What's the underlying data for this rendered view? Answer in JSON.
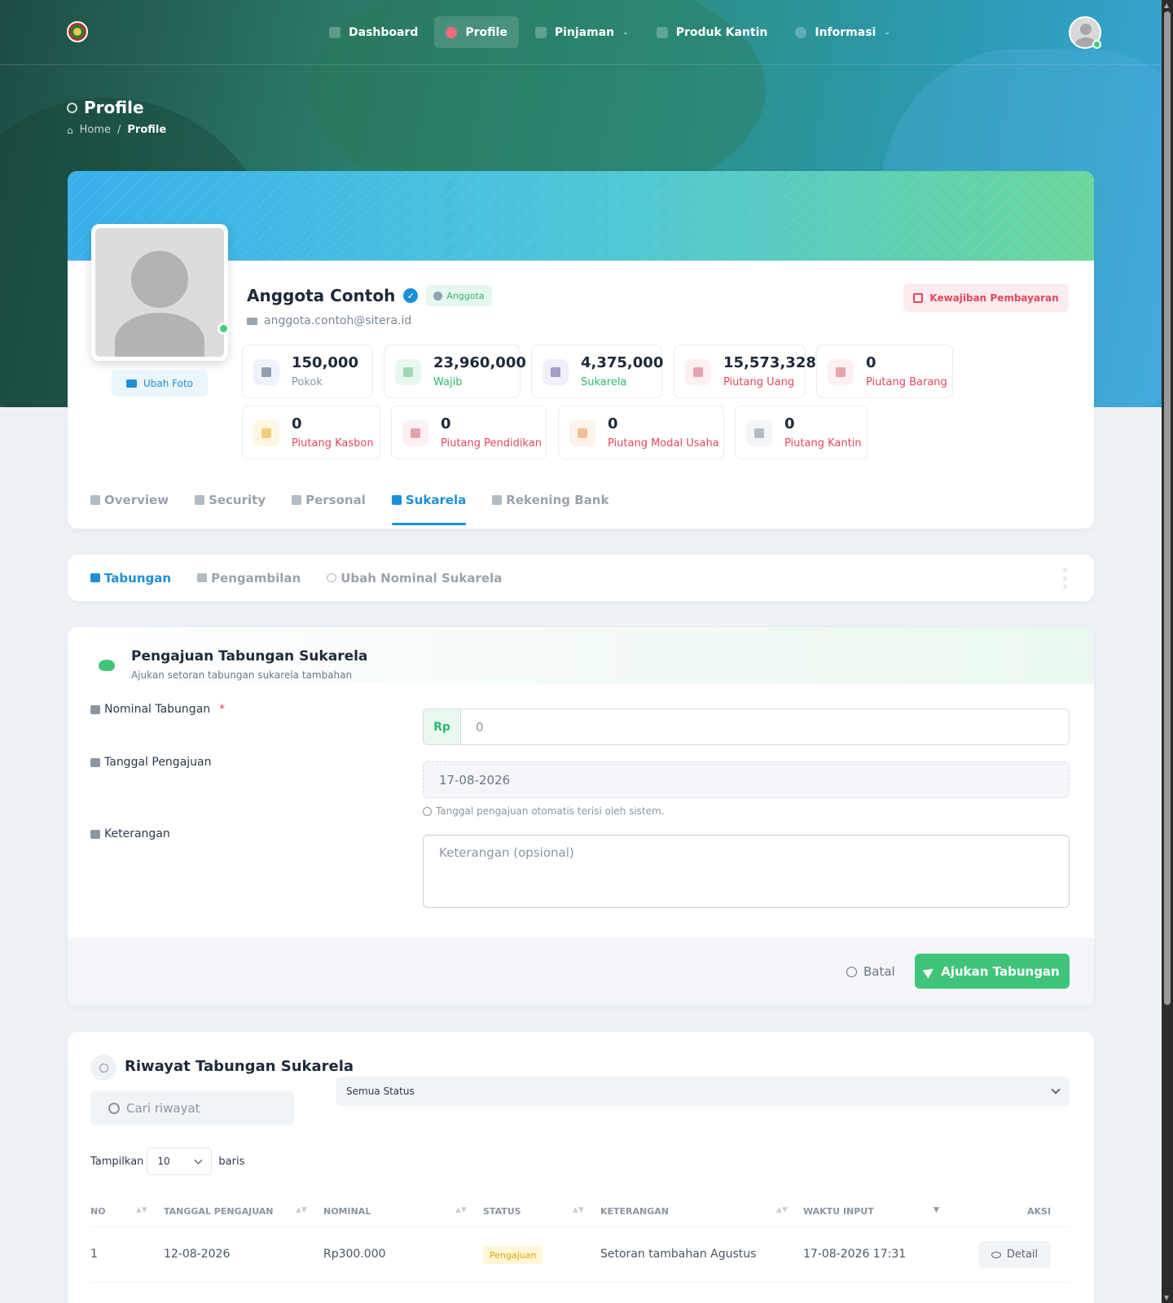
{
  "nav": {
    "items": [
      {
        "label": "Dashboard",
        "icon": "dashboard-icon",
        "active": false,
        "dropdown": false
      },
      {
        "label": "Profile",
        "icon": "user-icon",
        "active": true,
        "dropdown": false
      },
      {
        "label": "Pinjaman",
        "icon": "money-icon",
        "active": false,
        "dropdown": true
      },
      {
        "label": "Produk Kantin",
        "icon": "store-icon",
        "active": false,
        "dropdown": false
      },
      {
        "label": "Informasi",
        "icon": "info-icon",
        "active": false,
        "dropdown": true
      }
    ]
  },
  "page": {
    "title": "Profile",
    "breadcrumb": {
      "home": "Home",
      "sep": "/",
      "current": "Profile"
    }
  },
  "profile": {
    "name": "Anggota Contoh",
    "role": "Anggota",
    "email": "anggota.contoh@sitera.id",
    "change_photo": "Ubah Foto",
    "obligation_button": "Kewajiban Pembayaran",
    "stats": [
      {
        "value": "150,000",
        "label": "Pokok",
        "icon": "bank-icon",
        "label_color": "#8a96a3",
        "icon_bg": "#eef3fa",
        "icon_color": "#8fa0b3"
      },
      {
        "value": "23,960,000",
        "label": "Wajib",
        "icon": "shield-icon",
        "label_color": "#2fb86c",
        "icon_bg": "#e9f8ef",
        "icon_color": "#9fd9b4"
      },
      {
        "value": "4,375,000",
        "label": "Sukarela",
        "icon": "piggy-bank-icon",
        "label_color": "#2fb86c",
        "icon_bg": "#f1f0fa",
        "icon_color": "#a89ac9"
      },
      {
        "value": "15,573,328",
        "label": "Piutang Uang",
        "icon": "cash-icon",
        "label_color": "#e2475e",
        "icon_bg": "#fdf0f2",
        "icon_color": "#e6a3ad"
      },
      {
        "value": "0",
        "label": "Piutang Barang",
        "icon": "bag-icon",
        "label_color": "#e2475e",
        "icon_bg": "#fdf0f2",
        "icon_color": "#e6a3ad"
      },
      {
        "value": "0",
        "label": "Piutang Kasbon",
        "icon": "wallet-icon",
        "label_color": "#e2475e",
        "icon_bg": "#fdf6e3",
        "icon_color": "#f0cf7a"
      },
      {
        "value": "0",
        "label": "Piutang Pendidikan",
        "icon": "graduation-cap-icon",
        "label_color": "#e2475e",
        "icon_bg": "#fdf0f2",
        "icon_color": "#e6a3ad"
      },
      {
        "value": "0",
        "label": "Piutang Modal Usaha",
        "icon": "shop-icon",
        "label_color": "#e2475e",
        "icon_bg": "#fdf3ea",
        "icon_color": "#f1bf95"
      },
      {
        "value": "0",
        "label": "Piutang Kantin",
        "icon": "building-icon",
        "label_color": "#e2475e",
        "icon_bg": "#f3f5f8",
        "icon_color": "#b3bbc4"
      }
    ],
    "tabs": [
      {
        "label": "Overview",
        "icon": "grid-icon",
        "active": false
      },
      {
        "label": "Security",
        "icon": "shield-icon",
        "active": false
      },
      {
        "label": "Personal",
        "icon": "id-card-icon",
        "active": false
      },
      {
        "label": "Sukarela",
        "icon": "piggy-bank-icon",
        "active": true
      },
      {
        "label": "Rekening Bank",
        "icon": "bank-icon",
        "active": false
      }
    ]
  },
  "subtabs": [
    {
      "label": "Tabungan",
      "icon": "piggy-bank-icon",
      "active": true
    },
    {
      "label": "Pengambilan",
      "icon": "wallet-icon",
      "active": false
    },
    {
      "label": "Ubah Nominal Sukarela",
      "icon": "refresh-icon",
      "active": false
    }
  ],
  "form": {
    "title": "Pengajuan Tabungan Sukarela",
    "subtitle": "Ajukan setoran tabungan sukarela tambahan",
    "nominal_label": "Nominal Tabungan",
    "required_mark": "*",
    "nominal_prefix": "Rp",
    "nominal_placeholder": "0",
    "date_label": "Tanggal Pengajuan",
    "date_value": "17-08-2026",
    "date_hint": "Tanggal pengajuan otomatis terisi oleh sistem.",
    "note_label": "Keterangan",
    "note_placeholder": "Keterangan (opsional)",
    "cancel": "Batal",
    "submit": "Ajukan Tabungan"
  },
  "history": {
    "title": "Riwayat Tabungan Sukarela",
    "search_placeholder": "Cari riwayat",
    "status_filter": "Semua Status",
    "show_label": "Tampilkan",
    "rows_per_page": "10",
    "rows_suffix": "baris",
    "columns": [
      "NO",
      "TANGGAL PENGAJUAN",
      "NOMINAL",
      "STATUS",
      "KETERANGAN",
      "WAKTU INPUT",
      "AKSI"
    ],
    "rows": [
      {
        "no": "1",
        "tanggal": "12-08-2026",
        "nominal": "Rp300.000",
        "status": "Pengajuan",
        "keterangan": "Setoran tambahan Agustus",
        "waktu": "17-08-2026 17:31",
        "aksi": "Detail"
      }
    ]
  }
}
